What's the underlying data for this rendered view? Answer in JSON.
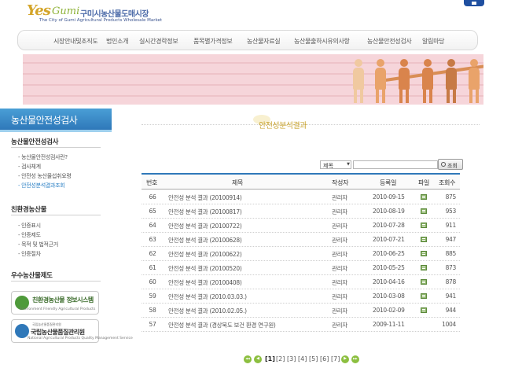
{
  "header": {
    "logo_yes": "Yes",
    "logo_gumi": "Gumi",
    "logo_korean": "구미시농산물도매시장",
    "logo_english": "The City of Gumi Agricultural Products Wholesale Market"
  },
  "nav": {
    "items": [
      {
        "label": "시장안내및조직도"
      },
      {
        "label": "법인소개"
      },
      {
        "label": "실시간경락정보"
      },
      {
        "label": "품목별가격정보"
      },
      {
        "label": "농산물자료실"
      },
      {
        "label": "농산물출하시유의사항"
      },
      {
        "label": "농산물안전성검사"
      },
      {
        "label": "알림마당"
      }
    ]
  },
  "sidebar": {
    "title": "농산물안전성검사",
    "section1": {
      "heading": "농산물안전성검사",
      "links": [
        {
          "label": "- 농산물안전성검사란?",
          "active": false
        },
        {
          "label": "- 검사체계",
          "active": false
        },
        {
          "label": "- 안전성 농산물섭취요령",
          "active": false
        },
        {
          "label": "- 안전성분석결과조회",
          "active": true
        }
      ]
    },
    "section2": {
      "heading": "친환경농산물",
      "links": [
        {
          "label": "- 인증표시"
        },
        {
          "label": "- 인증제도"
        },
        {
          "label": "- 목적 및 법적근거"
        },
        {
          "label": "- 인증절차"
        }
      ]
    },
    "section3": {
      "heading": "우수농산물제도"
    },
    "banner1": {
      "title": "친환경농산물 정보시스템",
      "subtitle": "Environment Friendly Agricultural Products"
    },
    "banner2": {
      "top": "국립농산물품질관리원",
      "title": "국립농산물품질관리원",
      "subtitle": "National Agricultural Products Quality Management Service"
    }
  },
  "content": {
    "title": "안전성분석결과"
  },
  "search": {
    "select_value": "제목",
    "input_value": "",
    "button_label": "조회"
  },
  "table": {
    "headers": {
      "no": "번호",
      "title": "제목",
      "author": "작성자",
      "date": "등록일",
      "file": "파일",
      "views": "조회수"
    },
    "rows": [
      {
        "no": "66",
        "title": "안전성 분석 결과 (20100914)",
        "author": "관리자",
        "date": "2010-09-15",
        "file": true,
        "views": "875"
      },
      {
        "no": "65",
        "title": "안전성 분석 결과 (20100817)",
        "author": "관리자",
        "date": "2010-08-19",
        "file": true,
        "views": "953"
      },
      {
        "no": "64",
        "title": "안전성 분석 결과 (20100722)",
        "author": "관리자",
        "date": "2010-07-28",
        "file": true,
        "views": "911"
      },
      {
        "no": "63",
        "title": "안전성 분석 결과 (20100628)",
        "author": "관리자",
        "date": "2010-07-21",
        "file": true,
        "views": "947"
      },
      {
        "no": "62",
        "title": "안전성 분석 결과 (20100622)",
        "author": "관리자",
        "date": "2010-06-25",
        "file": true,
        "views": "885"
      },
      {
        "no": "61",
        "title": "안전성 분석 결과 (20100520)",
        "author": "관리자",
        "date": "2010-05-25",
        "file": true,
        "views": "873"
      },
      {
        "no": "60",
        "title": "안전성 분석 결과 (20100408)",
        "author": "관리자",
        "date": "2010-04-16",
        "file": true,
        "views": "878"
      },
      {
        "no": "59",
        "title": "안전성 분석 결과 (2010.03.03.)",
        "author": "관리자",
        "date": "2010-03-08",
        "file": true,
        "views": "941"
      },
      {
        "no": "58",
        "title": "안전성 분석 결과 (2010.02.05.)",
        "author": "관리자",
        "date": "2010-02-09",
        "file": true,
        "views": "944"
      },
      {
        "no": "57",
        "title": "안전성 분석 결과 (경상북도 보건 환경 연구원)",
        "author": "관리자",
        "date": "2009-11-11",
        "file": false,
        "views": "1004"
      }
    ]
  },
  "pager": {
    "pages": [
      "[1]",
      "[2]",
      "[3]",
      "[4]",
      "[5]",
      "[6]",
      "[7]"
    ],
    "current": "[1]"
  },
  "colors": {
    "accent_blue": "#2f78b9",
    "title_gold": "#c9a32d",
    "pager_green": "#8cbf3f"
  }
}
